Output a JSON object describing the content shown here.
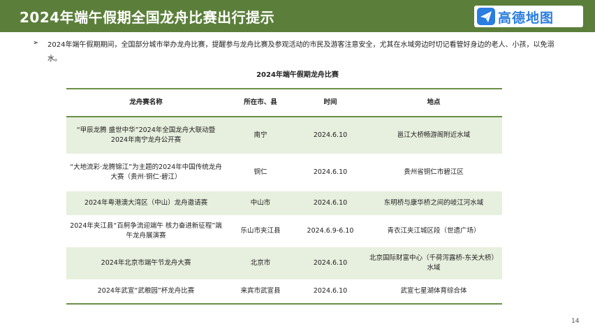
{
  "header": {
    "title": "2024年端午假期全国龙舟比赛出行提示",
    "logo_text": "高德地图",
    "logo_icon": "paper-plane-icon",
    "colors": {
      "bar": "#5b7f3a",
      "logo_text": "#2a7de1",
      "logo_icon": "#2a7de1"
    }
  },
  "intro": {
    "bullet": "➢",
    "text": "2024年端午假期期间，全国部分城市举办龙舟比赛，提醒参与龙舟比赛及参观活动的市民及游客注意安全，尤其在水域旁边时切记看管好身边的老人、小孩，以免溺水。"
  },
  "table": {
    "title": "2024年端午假期龙舟比赛",
    "headers": [
      "龙舟赛名称",
      "所在市、县",
      "时间",
      "地点"
    ],
    "rows": [
      {
        "name": "“甲辰龙腾 盛世中华”2024年全国龙舟大联动暨2024年南宁龙舟公开赛",
        "city": "南宁",
        "time": "2024.6.10",
        "place": "邕江大桥畅游阁附近水域"
      },
      {
        "name": "“大地流彩·龙腾锦江”为主题的2024年中国传统龙舟大赛（贵州·铜仁·碧江）",
        "city": "铜仁",
        "time": "2024.6.10",
        "place": "贵州省铜仁市碧江区"
      },
      {
        "name": "2024年粤港澳大湾区（中山）龙舟邀请赛",
        "city": "中山市",
        "time": "2024.6.10",
        "place": "东明桥与康华桥之间的岐江河水域"
      },
      {
        "name": "2024年夹江县“百舸争流迎端午 核力奋进新征程”端午龙舟展演赛",
        "city": "乐山市夹江县",
        "time": "2024.6.9-6.10",
        "place": "青衣江夹江城区段（世遗广场）"
      },
      {
        "name": "2024年北京市端午节龙舟大赛",
        "city": "北京市",
        "time": "2024.6.10",
        "place": "北京国际财富中心（千荷泻露桥-东关大桥）水域"
      },
      {
        "name": "2024年武宣“武粮园”杯龙舟比赛",
        "city": "来宾市武宣县",
        "time": "2024.6.10",
        "place": "武宣七星湖体育综合体"
      }
    ],
    "colors": {
      "rule": "#6a8f45",
      "shade": "#e7efde"
    }
  },
  "page_number": "14"
}
